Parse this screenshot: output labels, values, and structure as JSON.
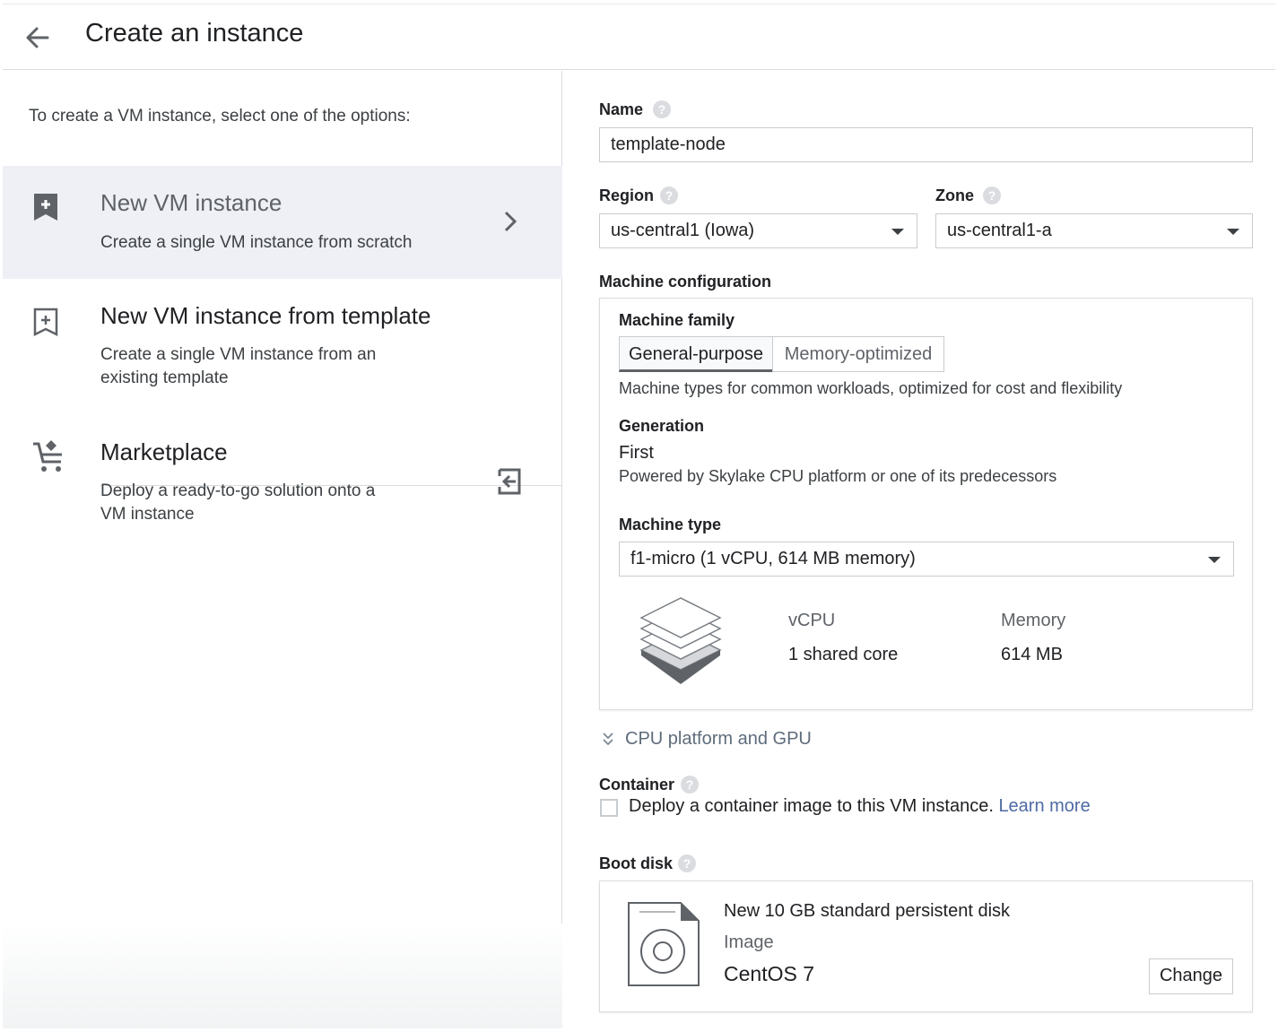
{
  "header": {
    "title": "Create an instance"
  },
  "left": {
    "intro": "To create a VM instance, select one of the options:",
    "options": [
      {
        "title": "New VM instance",
        "description": "Create a single VM instance from scratch"
      },
      {
        "title": "New VM instance from template",
        "description": "Create a single VM instance from an existing template"
      },
      {
        "title": "Marketplace",
        "description": "Deploy a ready-to-go solution onto a VM instance"
      }
    ]
  },
  "form": {
    "name_label": "Name",
    "name_value": "template-node",
    "region_label": "Region",
    "region_value": "us-central1 (Iowa)",
    "zone_label": "Zone",
    "zone_value": "us-central1-a",
    "machine_config_label": "Machine configuration",
    "machine_family_label": "Machine family",
    "family_tabs": [
      "General-purpose",
      "Memory-optimized"
    ],
    "family_description": "Machine types for common workloads, optimized for cost and flexibility",
    "generation_label": "Generation",
    "generation_value": "First",
    "generation_description": "Powered by Skylake CPU platform or one of its predecessors",
    "machine_type_label": "Machine type",
    "machine_type_value": "f1-micro (1 vCPU, 614 MB memory)",
    "vcpu_label": "vCPU",
    "vcpu_value": "1 shared core",
    "memory_label": "Memory",
    "memory_value": "614 MB",
    "cpu_platform_toggle": "CPU platform and GPU",
    "container_label": "Container",
    "container_checkbox_text": "Deploy a container image to this VM instance.",
    "container_learn_more": "Learn more",
    "boot_disk_label": "Boot disk",
    "boot_disk_title": "New 10 GB standard persistent disk",
    "boot_disk_image_label": "Image",
    "boot_disk_image_value": "CentOS 7",
    "change_button": "Change",
    "help_glyph": "?"
  },
  "colors": {
    "selected_option_bg": "#eef0f5",
    "link": "#4e6aa3",
    "border": "#dadce0"
  }
}
